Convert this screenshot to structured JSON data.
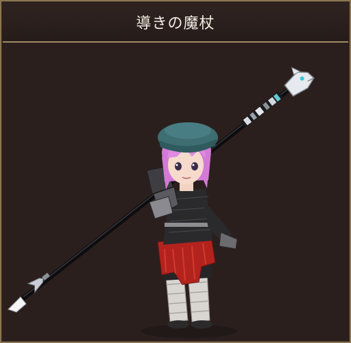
{
  "window": {
    "title": "導きの魔杖"
  },
  "preview": {
    "item_icon": "staff-icon",
    "character_icon": "character-model-icon"
  },
  "colors": {
    "frame_border": "#8c7652",
    "title_divider": "#a08a63",
    "background": "#2b1f1e",
    "title_text": "#f2ece2"
  }
}
